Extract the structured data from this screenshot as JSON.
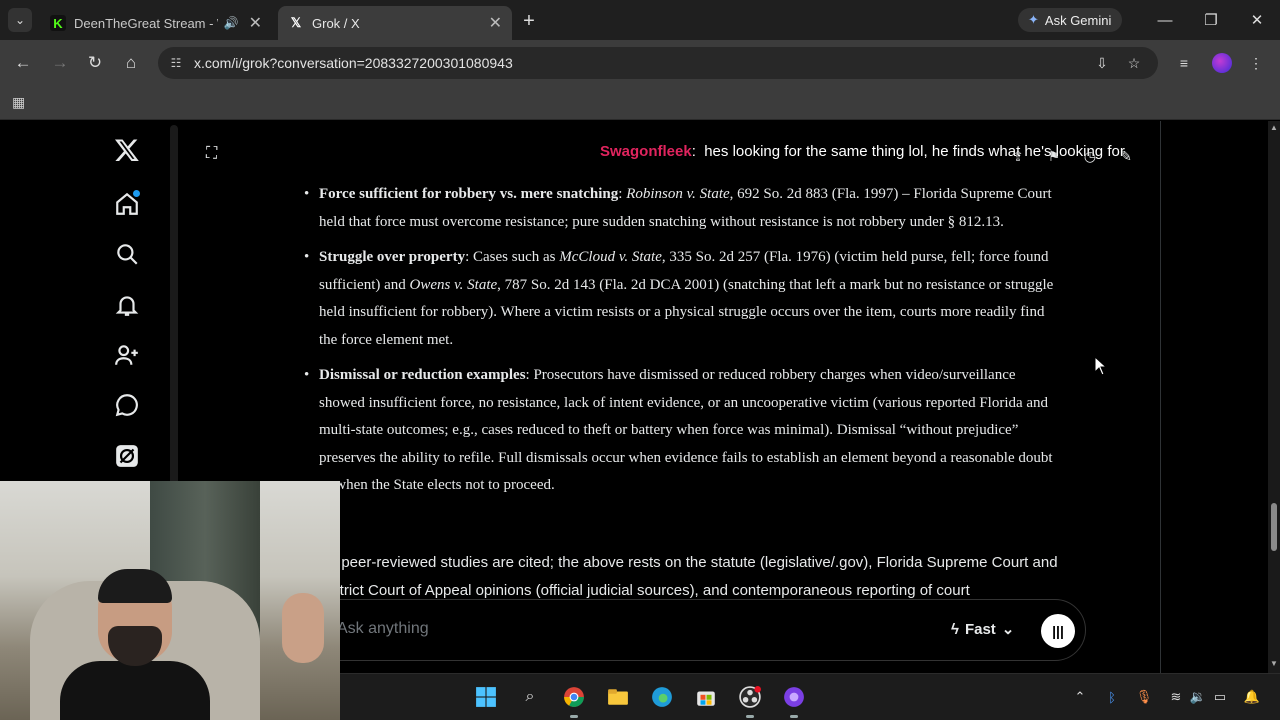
{
  "browser": {
    "tabs": [
      {
        "title": "DeenTheGreat Stream - Wa",
        "favicon": "kick-logo-icon",
        "audio": true,
        "active": false
      },
      {
        "title": "Grok / X",
        "favicon": "x-logo-icon",
        "active": true
      }
    ],
    "ask_gemini_label": "Ask Gemini",
    "url": "x.com/i/grok?conversation=2083327200301080943"
  },
  "chat_overlay": {
    "username": "Swagonfleek",
    "message": "hes looking for the same thing lol, he finds what he's looking for"
  },
  "response": {
    "bullets": [
      {
        "heading": "Force sufficient for robbery vs. mere snatching",
        "case_name": "Robinson v. State",
        "text": ", 692 So. 2d 883 (Fla. 1997) – Florida Supreme Court held that force must overcome resistance; pure sudden snatching without resistance is not robbery under § 812.13."
      },
      {
        "heading": "Struggle over property",
        "text_a": ": Cases such as ",
        "case_a": "McCloud v. State",
        "text_b": ", 335 So. 2d 257 (Fla. 1976) (victim held purse, fell; force found sufficient) and ",
        "case_b": "Owens v. State",
        "text_c": ", 787 So. 2d 143 (Fla. 2d DCA 2001) (snatching that left a mark but no resistance or struggle held insufficient for robbery). Where a victim resists or a physical struggle occurs over the item, courts more readily find the force element met."
      },
      {
        "heading": "Dismissal or reduction examples",
        "text": ": Prosecutors have dismissed or reduced robbery charges when video/surveillance showed insufficient force, no resistance, lack of intent evidence, or an uncooperative victim (various reported Florida and multi-state outcomes; e.g., cases reduced to theft or battery when force was minimal). Dismissal “without prejudice” preserves the ability to refile. Full dismissals occur when evidence fails to establish an element beyond a reasonable doubt or when the State elects not to proceed."
      }
    ],
    "summary": "No peer-reviewed studies are cited; the above rests on the statute (legislative/.gov), Florida Supreme Court and District Court of Appeal opinions (official judicial sources), and contemporaneous reporting of court"
  },
  "composer": {
    "placeholder": "Ask anything",
    "model_label": "Fast"
  },
  "colors": {
    "username": "#e0245e",
    "accent": "#1d9bf0",
    "background": "#000000"
  }
}
